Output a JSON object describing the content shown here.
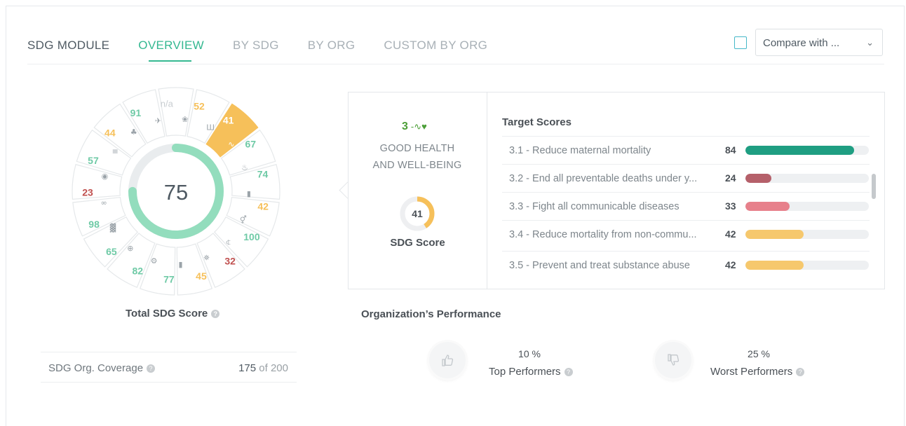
{
  "tabs": [
    "SDG MODULE",
    "OVERVIEW",
    "BY SDG",
    "BY ORG",
    "CUSTOM BY ORG"
  ],
  "compare": {
    "label": "Compare with ...",
    "checked": false
  },
  "colors": {
    "accent": "#35b891",
    "highlight": "#f6c05a",
    "red": "#c0504f",
    "bar_green": "#1f9e82",
    "bar_maroon": "#b5606a",
    "bar_pink": "#e7808b",
    "bar_yellow": "#f6c86d"
  },
  "wheel": {
    "total_score": "75",
    "total_score_fraction": 0.75,
    "title": "Total SDG Score",
    "segments": [
      {
        "goal": 1,
        "value": "n/a",
        "icon": "family-icon"
      },
      {
        "goal": 2,
        "value": "52",
        "icon": "agriculture-icon"
      },
      {
        "goal": 3,
        "value": "41",
        "icon": "health-pulse-icon",
        "selected": true
      },
      {
        "goal": 4,
        "value": "67",
        "icon": "education-icon"
      },
      {
        "goal": 5,
        "value": "74",
        "icon": "book-icon"
      },
      {
        "goal": 6,
        "value": "42",
        "icon": "gender-icon"
      },
      {
        "goal": 7,
        "value": "100",
        "icon": "water-icon"
      },
      {
        "goal": 8,
        "value": "32",
        "icon": "sun-energy-icon"
      },
      {
        "goal": 9,
        "value": "45",
        "icon": "growth-chart-icon"
      },
      {
        "goal": 10,
        "value": "77",
        "icon": "industry-icon"
      },
      {
        "goal": 11,
        "value": "82",
        "icon": "inequality-icon"
      },
      {
        "goal": 12,
        "value": "65",
        "icon": "city-icon"
      },
      {
        "goal": 13,
        "value": "98",
        "icon": "infinity-icon"
      },
      {
        "goal": 14,
        "value": "23",
        "icon": "eye-climate-icon"
      },
      {
        "goal": 15,
        "value": "57",
        "icon": "fish-icon"
      },
      {
        "goal": 16,
        "value": "44",
        "icon": "tree-icon"
      },
      {
        "goal": 17,
        "value": "91",
        "icon": "dove-icon"
      }
    ]
  },
  "coverage": {
    "label": "SDG Org. Coverage",
    "value": "175",
    "of": "of 200"
  },
  "detail": {
    "sdg_number": "3",
    "sdg_name_line1": "GOOD HEALTH",
    "sdg_name_line2": "AND WELL-BEING",
    "sdg_score": "41",
    "sdg_score_fraction": 0.41,
    "sdg_score_label": "SDG Score",
    "targets_title": "Target Scores",
    "targets": [
      {
        "label": "3.1 - Reduce maternal mortality",
        "value": "84",
        "fraction": 0.88,
        "color": "#1f9e82"
      },
      {
        "label": "3.2 - End all preventable deaths under y...",
        "value": "24",
        "fraction": 0.21,
        "color": "#b5606a"
      },
      {
        "label": "3.3 - Fight all communicable diseases",
        "value": "33",
        "fraction": 0.36,
        "color": "#e7808b"
      },
      {
        "label": "3.4 - Reduce mortality from non-commu...",
        "value": "42",
        "fraction": 0.47,
        "color": "#f6c86d"
      },
      {
        "label": "3.5 - Prevent and treat substance abuse",
        "value": "42",
        "fraction": 0.47,
        "color": "#f6c86d"
      }
    ]
  },
  "org_performance": {
    "title": "Organization’s Performance",
    "top": {
      "pct": "10 %",
      "label": "Top Performers",
      "icon": "thumbs-up-icon"
    },
    "worst": {
      "pct": "25 %",
      "label": "Worst Performers",
      "icon": "thumbs-down-icon"
    }
  }
}
